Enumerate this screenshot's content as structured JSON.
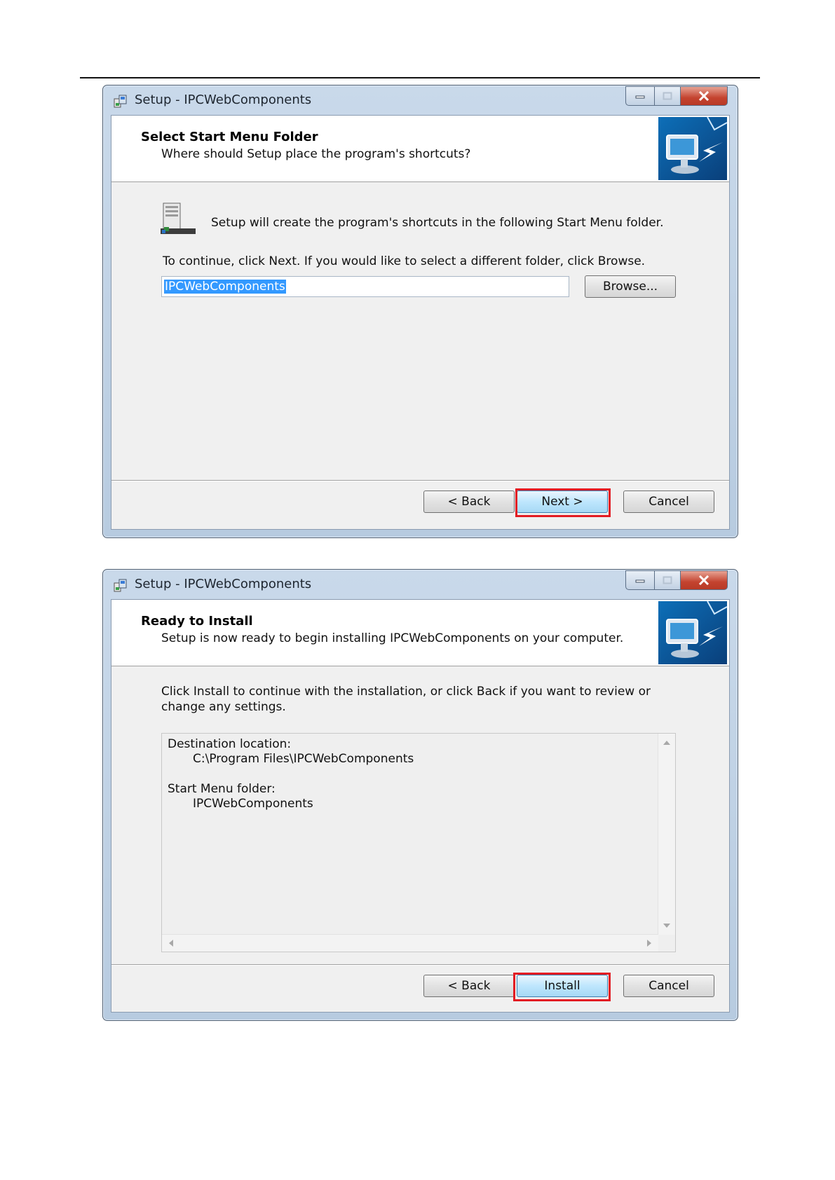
{
  "window1": {
    "title": "Setup - IPCWebComponents",
    "header_title": "Select Start Menu Folder",
    "header_subtitle": "Where should Setup place the program's shortcuts?",
    "intro": "Setup will create the program's shortcuts in the following Start Menu folder.",
    "instruction": "To continue, click Next. If you would like to select a different folder, click Browse.",
    "folder_value": "IPCWebComponents",
    "browse_label": "Browse...",
    "back_label": "< Back",
    "next_label": "Next >",
    "cancel_label": "Cancel"
  },
  "window2": {
    "title": "Setup - IPCWebComponents",
    "header_title": "Ready to Install",
    "header_subtitle": "Setup is now ready to begin installing IPCWebComponents on your computer.",
    "instruction_line1": "Click Install to continue with the installation, or click Back if you want to review or",
    "instruction_line2": "change any settings.",
    "memo": {
      "dest_label": "Destination location:",
      "dest_value": "C:\\Program Files\\IPCWebComponents",
      "menu_label": "Start Menu folder:",
      "menu_value": "IPCWebComponents"
    },
    "back_label": "< Back",
    "install_label": "Install",
    "cancel_label": "Cancel"
  },
  "colors": {
    "highlight": "#e21b23",
    "selection": "#3399ff"
  },
  "icons": [
    "setup-app-icon",
    "minimize-icon",
    "maximize-icon",
    "close-icon",
    "wizard-computer-icon",
    "start-menu-folder-icon",
    "scroll-up-icon",
    "scroll-down-icon",
    "scroll-left-icon",
    "scroll-right-icon"
  ]
}
